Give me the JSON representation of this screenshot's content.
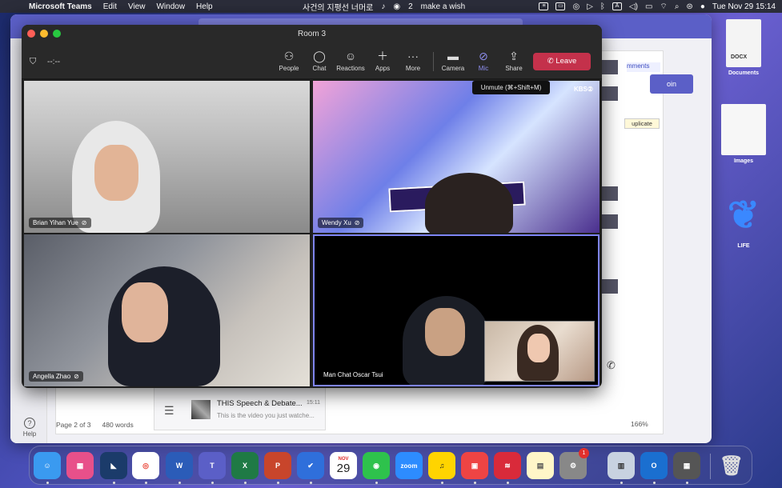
{
  "menubar": {
    "app_name": "Microsoft Teams",
    "menus": [
      "Edit",
      "View",
      "Window",
      "Help"
    ],
    "korean_text": "사건의 지평선 너머로",
    "wechat_count": "2",
    "make_a_wish": "make a wish",
    "datetime": "Tue Nov 29  15:14"
  },
  "call": {
    "title": "Room 3",
    "timer": "--:--",
    "controls": [
      {
        "label": "People",
        "icon": "people-icon"
      },
      {
        "label": "Chat",
        "icon": "chat-icon"
      },
      {
        "label": "Reactions",
        "icon": "reactions-icon"
      },
      {
        "label": "Apps",
        "icon": "plus-icon"
      },
      {
        "label": "More",
        "icon": "more-icon"
      },
      {
        "label": "Camera",
        "icon": "camera-icon"
      },
      {
        "label": "Mic",
        "icon": "mic-muted-icon"
      },
      {
        "label": "Share",
        "icon": "share-icon"
      }
    ],
    "leave_label": "Leave",
    "tooltip": "Unmute (⌘+Shift+M)",
    "participants": [
      {
        "name": "Brian Yihan Yue"
      },
      {
        "name": "Wendy Xu"
      },
      {
        "name": "Angella Zhao"
      },
      {
        "name": "Man Chat Oscar Tsui"
      }
    ],
    "tv_overlay": {
      "channel": "KBS②",
      "banner": "Rea    ue"
    }
  },
  "background": {
    "comments_label": "mments",
    "join_label": "oin",
    "duplicate_label": "uplicate",
    "help_label": "Help",
    "page_info": "Page 2 of 3",
    "word_count": "480 words",
    "zoom": "166%",
    "chat_preview": {
      "title": "THIS Speech & Debate...",
      "time": "15:11",
      "subtitle": "This is the video you just watche..."
    }
  },
  "desktop": {
    "icons": [
      {
        "label": "Documents",
        "tag": "DOCX"
      },
      {
        "label": "Images"
      },
      {
        "label": "LIFE"
      }
    ]
  },
  "dock": {
    "calendar_month": "NOV",
    "calendar_day": "29",
    "zoom_label": "zoom",
    "system_prefs_badge": "1"
  }
}
